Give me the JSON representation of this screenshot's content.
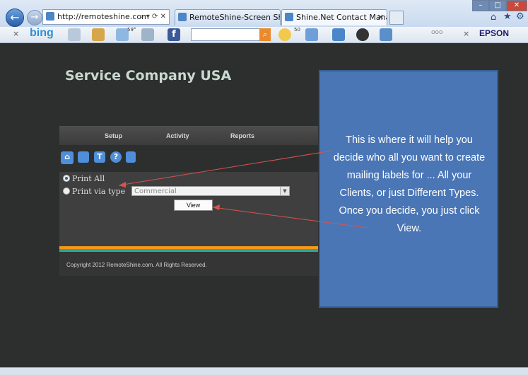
{
  "browser": {
    "address": "http://remoteshine.com",
    "tabs": [
      {
        "label": "RemoteShine-Screen Shots"
      },
      {
        "label": "Shine.Net Contact Manage..."
      }
    ],
    "toolbar": {
      "bing_label": "bing",
      "fb_label": "f",
      "badge_59": "59°",
      "badge_50": "50",
      "more_label": "ooo",
      "epson_label": "EPSON"
    }
  },
  "page": {
    "company_title": "Service Company USA",
    "nav": [
      "Setup",
      "Activity",
      "Reports"
    ],
    "form": {
      "print_all_label": "Print All",
      "print_via_type_label": "Print via type",
      "type_select_value": "Commercial",
      "view_button_label": "View"
    },
    "copyright": "Copyright 2012 RemoteShine.com. All Rights Reserved."
  },
  "callout": {
    "text": "This is where it will help you decide who all you want to create mailing labels for ... All your Clients, or just Different Types. Once you decide, you just click View."
  },
  "colors": {
    "callout_bg": "#4a76b6",
    "stripe_orange": "#f59a1a",
    "stripe_teal": "#2aa7a0",
    "arrow": "#d9534f"
  }
}
